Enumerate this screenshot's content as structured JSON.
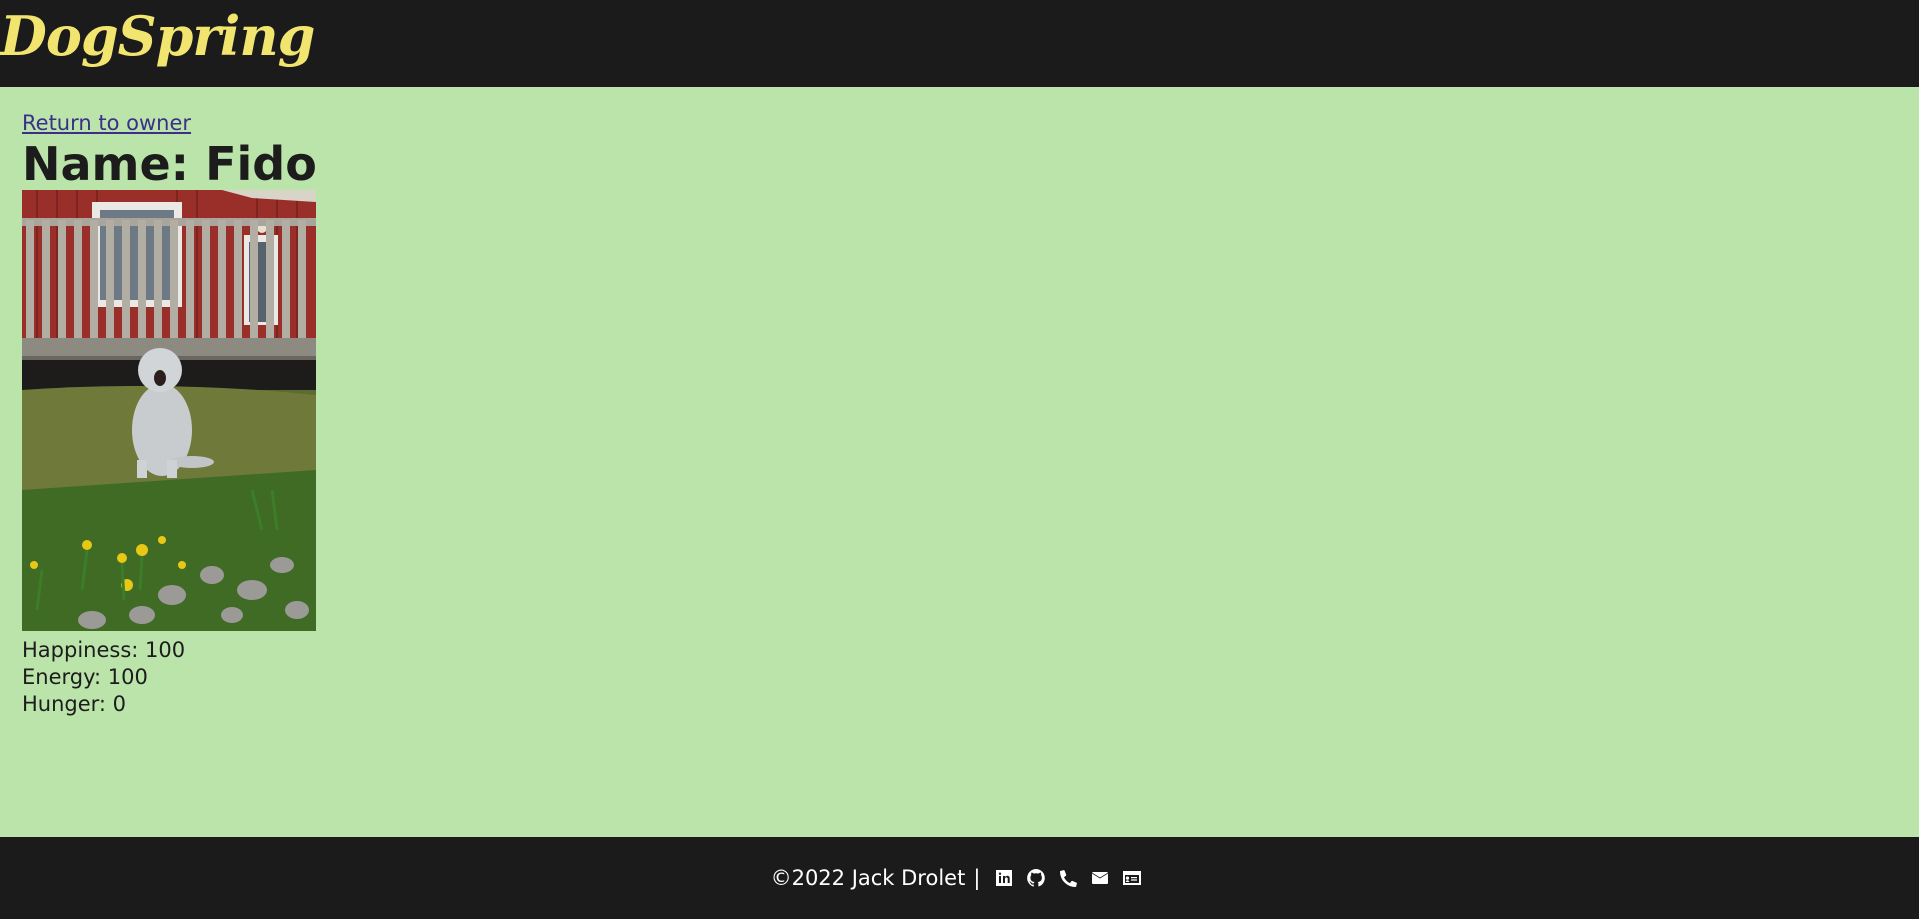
{
  "header": {
    "brand": "DogSpring",
    "brand_color": "#f2e56f"
  },
  "main": {
    "return_link": "Return to owner",
    "name_heading": "Name: Fido",
    "photo_alt": "",
    "stats": [
      {
        "label": "Happiness: 100"
      },
      {
        "label": "Energy: 100"
      },
      {
        "label": "Hunger: 0"
      }
    ]
  },
  "footer": {
    "copyright": "©2022 Jack Drolet",
    "separator": "|",
    "icons": [
      "linkedin-icon",
      "github-icon",
      "phone-icon",
      "envelope-icon",
      "id-card-icon"
    ]
  },
  "colors": {
    "background": "#bbe4aa",
    "header_bg": "#1b1b1b",
    "link": "#3b2f8a"
  }
}
